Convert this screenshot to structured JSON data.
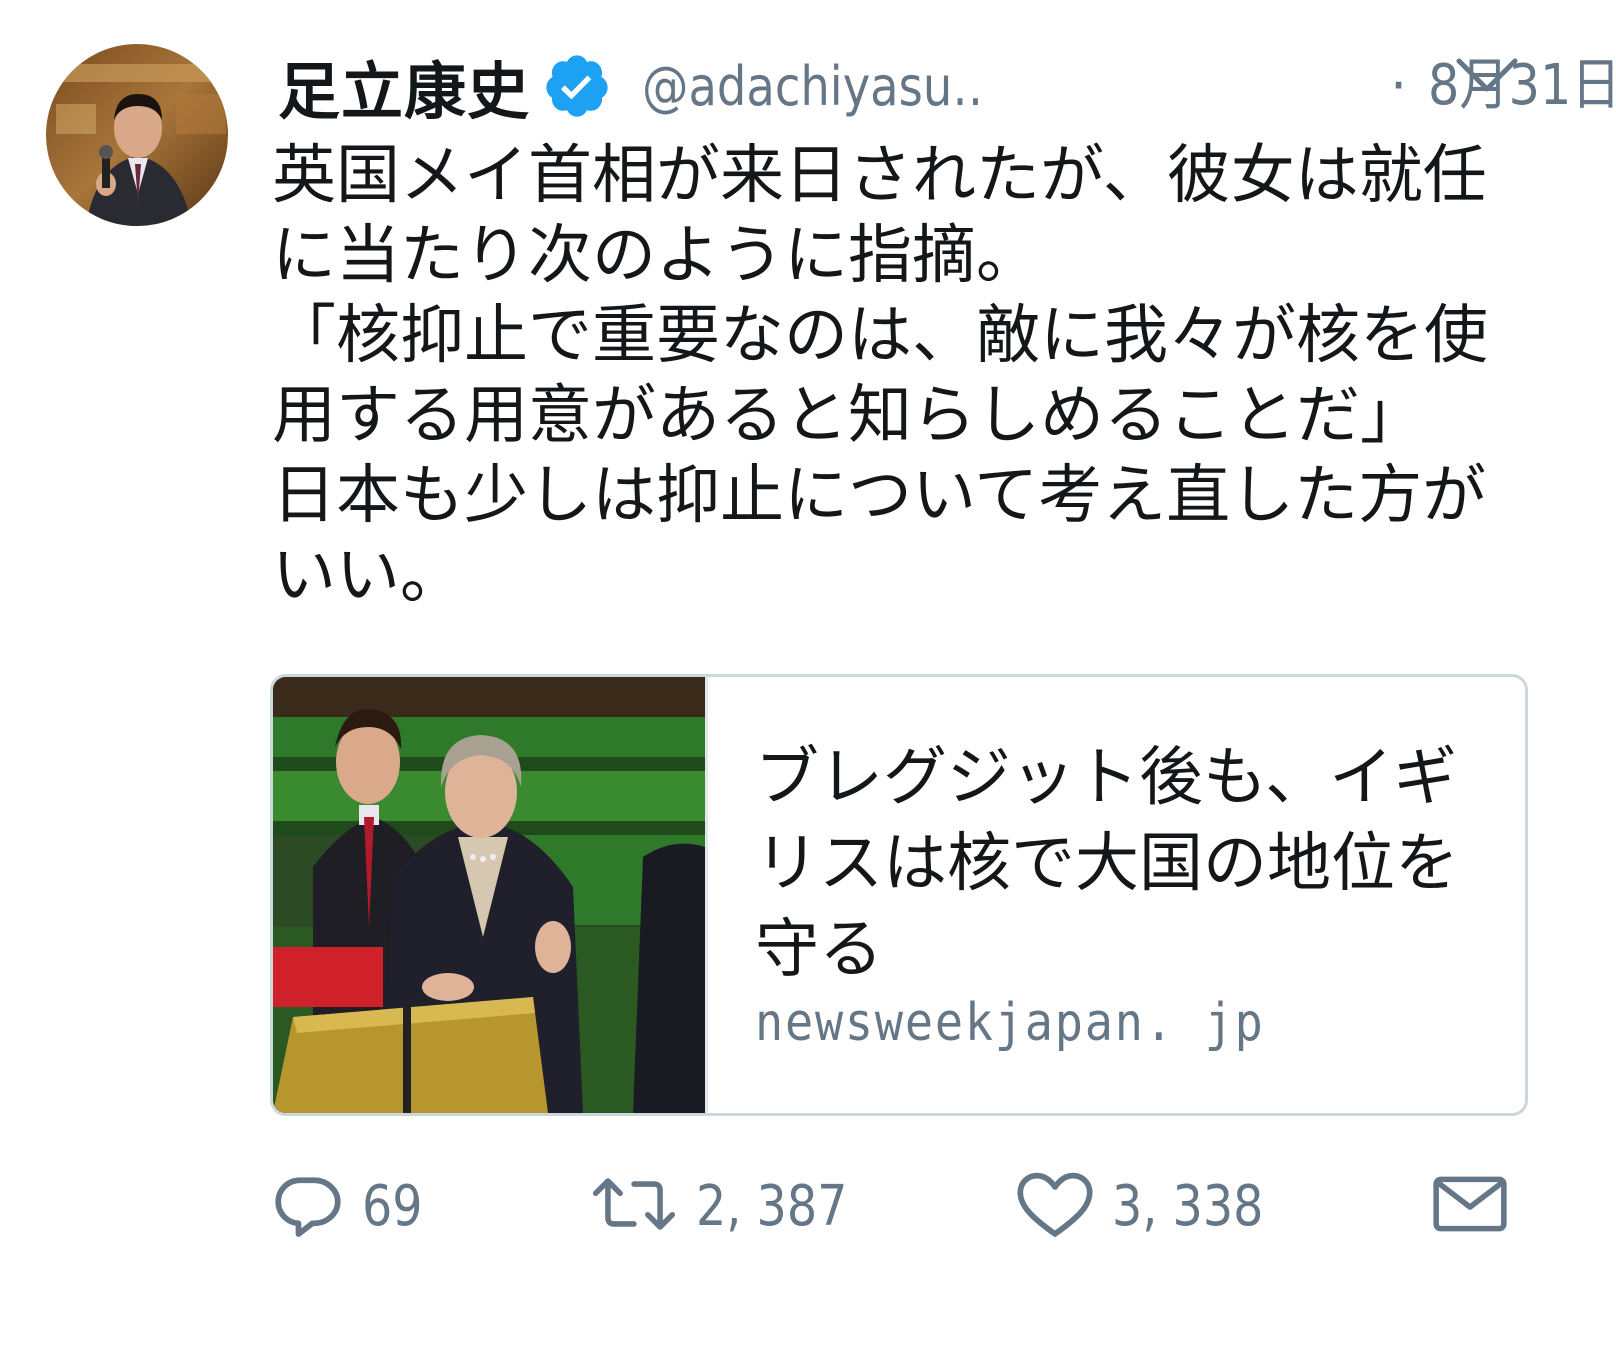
{
  "tweet": {
    "author": {
      "display_name": "足立康史",
      "handle": "@adachiyasu…",
      "verified_icon": "verified-badge-icon"
    },
    "separator": "·",
    "date": "8月31日",
    "menu_icon": "chevron-down-icon",
    "text_lines": [
      "英国メイ首相が来日されたが、彼女は就任",
      "に当たり次のように指摘。",
      "「核抑止で重要なのは、敵に我々が核を使",
      "用する用意があると知らしめることだ」",
      "日本も少しは抑止について考え直した方が",
      "いい。"
    ],
    "card": {
      "title_lines": [
        "ブレグジット後も、イギ",
        "リスは核で大国の地位を",
        "守る"
      ],
      "domain": "newsweekjapan. jp"
    },
    "actions": {
      "reply": {
        "icon": "reply-icon",
        "count": "69"
      },
      "retweet": {
        "icon": "retweet-icon",
        "count": "2, 387"
      },
      "like": {
        "icon": "heart-icon",
        "count": "3, 338"
      },
      "dm": {
        "icon": "envelope-icon"
      }
    }
  },
  "colors": {
    "text": "#14171a",
    "secondary": "#657786",
    "verified": "#1da1f2",
    "border": "#ccd6dd"
  }
}
